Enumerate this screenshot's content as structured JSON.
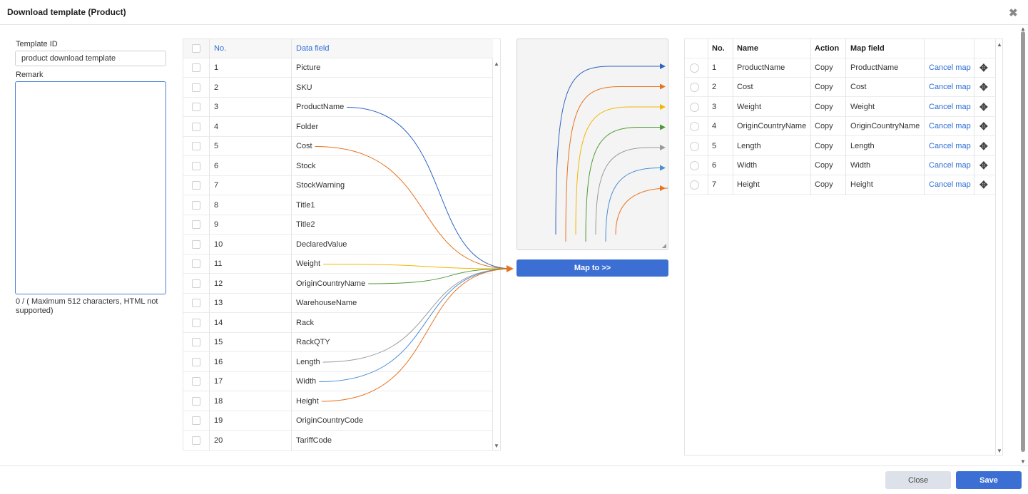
{
  "dialog": {
    "title": "Download template (Product)",
    "close_symbol": "✖"
  },
  "form": {
    "template_id_label": "Template ID",
    "template_id_value": "product download template",
    "remark_label": "Remark",
    "remark_value": "",
    "remark_hint": "0 / ( Maximum 512 characters, HTML not supported)"
  },
  "source_table": {
    "headers": {
      "no": "No.",
      "field": "Data field"
    },
    "rows": [
      {
        "no": "1",
        "field": "Picture"
      },
      {
        "no": "2",
        "field": "SKU"
      },
      {
        "no": "3",
        "field": "ProductName"
      },
      {
        "no": "4",
        "field": "Folder"
      },
      {
        "no": "5",
        "field": "Cost"
      },
      {
        "no": "6",
        "field": "Stock"
      },
      {
        "no": "7",
        "field": "StockWarning"
      },
      {
        "no": "8",
        "field": "Title1"
      },
      {
        "no": "9",
        "field": "Title2"
      },
      {
        "no": "10",
        "field": "DeclaredValue"
      },
      {
        "no": "11",
        "field": "Weight"
      },
      {
        "no": "12",
        "field": "OriginCountryName"
      },
      {
        "no": "13",
        "field": "WarehouseName"
      },
      {
        "no": "14",
        "field": "Rack"
      },
      {
        "no": "15",
        "field": "RackQTY"
      },
      {
        "no": "16",
        "field": "Length"
      },
      {
        "no": "17",
        "field": "Width"
      },
      {
        "no": "18",
        "field": "Height"
      },
      {
        "no": "19",
        "field": "OriginCountryCode"
      },
      {
        "no": "20",
        "field": "TariffCode"
      }
    ]
  },
  "mapping_lines": [
    {
      "source_row": 3,
      "color": "#2f65c0"
    },
    {
      "source_row": 5,
      "color": "#e8731f"
    },
    {
      "source_row": 11,
      "color": "#f2b800"
    },
    {
      "source_row": 12,
      "color": "#4f9a35"
    },
    {
      "source_row": 16,
      "color": "#9a9a9a"
    },
    {
      "source_row": 17,
      "color": "#4a8fd6"
    },
    {
      "source_row": 18,
      "color": "#e8731f"
    }
  ],
  "preview_colors": [
    "#2f65c0",
    "#e8731f",
    "#f2b800",
    "#4f9a35",
    "#9a9a9a",
    "#4a8fd6",
    "#e8731f"
  ],
  "map_button_label": "Map to >>",
  "target_table": {
    "headers": {
      "no": "No.",
      "name": "Name",
      "action": "Action",
      "map_field": "Map field"
    },
    "rows": [
      {
        "no": "1",
        "name": "ProductName",
        "action": "Copy",
        "map_field": "ProductName",
        "cancel": "Cancel map"
      },
      {
        "no": "2",
        "name": "Cost",
        "action": "Copy",
        "map_field": "Cost",
        "cancel": "Cancel map"
      },
      {
        "no": "3",
        "name": "Weight",
        "action": "Copy",
        "map_field": "Weight",
        "cancel": "Cancel map"
      },
      {
        "no": "4",
        "name": "OriginCountryName",
        "action": "Copy",
        "map_field": "OriginCountryName",
        "cancel": "Cancel map"
      },
      {
        "no": "5",
        "name": "Length",
        "action": "Copy",
        "map_field": "Length",
        "cancel": "Cancel map"
      },
      {
        "no": "6",
        "name": "Width",
        "action": "Copy",
        "map_field": "Width",
        "cancel": "Cancel map"
      },
      {
        "no": "7",
        "name": "Height",
        "action": "Copy",
        "map_field": "Height",
        "cancel": "Cancel map"
      }
    ]
  },
  "footer": {
    "close_label": "Close",
    "save_label": "Save"
  }
}
